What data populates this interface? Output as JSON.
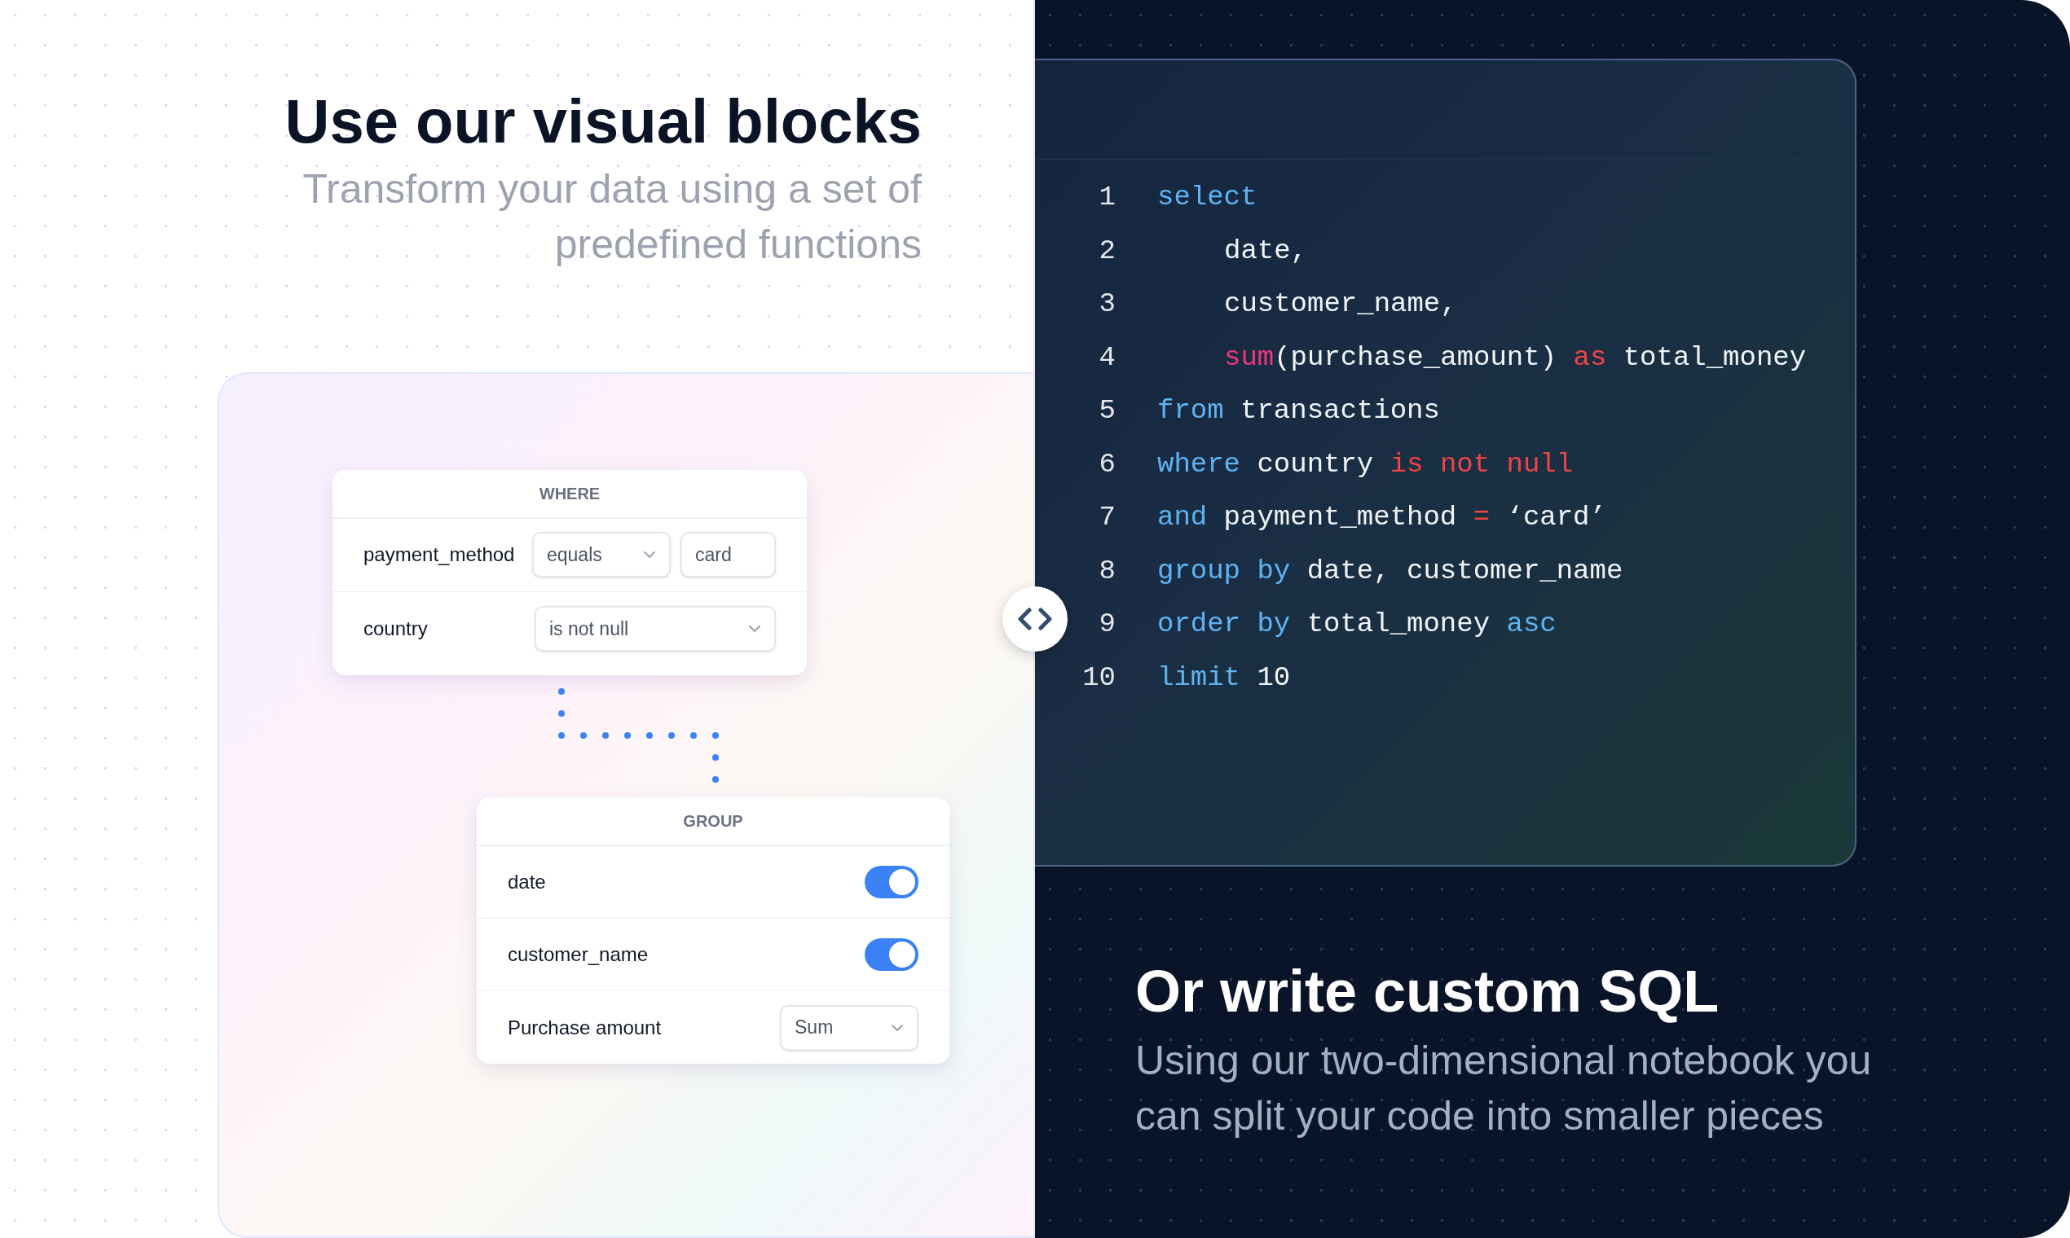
{
  "visual": {
    "title": "Use our visual blocks",
    "subtitle": "Transform your data using a set of predefined functions"
  },
  "where_block": {
    "title": "WHERE",
    "rows": [
      {
        "label": "payment_method",
        "controls": [
          {
            "kind": "select",
            "value": "equals"
          },
          {
            "kind": "input",
            "value": "card"
          }
        ]
      },
      {
        "label": "country",
        "controls": [
          {
            "kind": "wide-select",
            "value": "is not null"
          }
        ]
      }
    ]
  },
  "group_block": {
    "title": "GROUP",
    "rows": [
      {
        "label": "date",
        "kind": "toggle",
        "on": true
      },
      {
        "label": "customer_name",
        "kind": "toggle",
        "on": true
      },
      {
        "label": "Purchase amount",
        "kind": "select",
        "value": "Sum"
      }
    ]
  },
  "code": {
    "lines": [
      {
        "number": "1",
        "kind": "clause",
        "tokens": [
          {
            "kind": "keyword",
            "text": "select"
          }
        ]
      },
      {
        "number": "2",
        "kind": "column",
        "tokens": [
          {
            "kind": "plain",
            "text": "date,"
          }
        ]
      },
      {
        "number": "3",
        "kind": "column",
        "tokens": [
          {
            "kind": "plain",
            "text": "customer_name,"
          }
        ]
      },
      {
        "number": "4",
        "kind": "column",
        "tokens": [
          {
            "kind": "function",
            "text": "sum"
          },
          {
            "kind": "plain",
            "text": "(purchase_amount) "
          },
          {
            "kind": "operator",
            "text": "as"
          },
          {
            "kind": "plain",
            "text": " total_money"
          }
        ]
      },
      {
        "number": "5",
        "kind": "clause",
        "tokens": [
          {
            "kind": "keyword",
            "text": "from"
          },
          {
            "kind": "plain",
            "text": " transactions"
          }
        ]
      },
      {
        "number": "6",
        "kind": "clause",
        "tokens": [
          {
            "kind": "keyword",
            "text": "where"
          },
          {
            "kind": "plain",
            "text": " country "
          },
          {
            "kind": "operator",
            "text": "is not null"
          }
        ]
      },
      {
        "number": "7",
        "kind": "clause",
        "tokens": [
          {
            "kind": "keyword",
            "text": "and"
          },
          {
            "kind": "plain",
            "text": " payment_method "
          },
          {
            "kind": "operator",
            "text": "="
          },
          {
            "kind": "plain",
            "text": " ‘card’"
          }
        ]
      },
      {
        "number": "8",
        "kind": "clause",
        "tokens": [
          {
            "kind": "keyword",
            "text": "group by"
          },
          {
            "kind": "plain",
            "text": " date, customer_name"
          }
        ]
      },
      {
        "number": "9",
        "kind": "clause",
        "tokens": [
          {
            "kind": "keyword",
            "text": "order by"
          },
          {
            "kind": "plain",
            "text": " total_money "
          },
          {
            "kind": "keyword",
            "text": "asc"
          }
        ]
      },
      {
        "number": "10",
        "kind": "clause",
        "tokens": [
          {
            "kind": "keyword",
            "text": "limit"
          },
          {
            "kind": "plain",
            "text": " 10"
          }
        ]
      }
    ]
  },
  "sql": {
    "title": "Or write custom SQL",
    "subtitle": "Using our two-dimensional notebook you can split your code into smaller pieces"
  }
}
